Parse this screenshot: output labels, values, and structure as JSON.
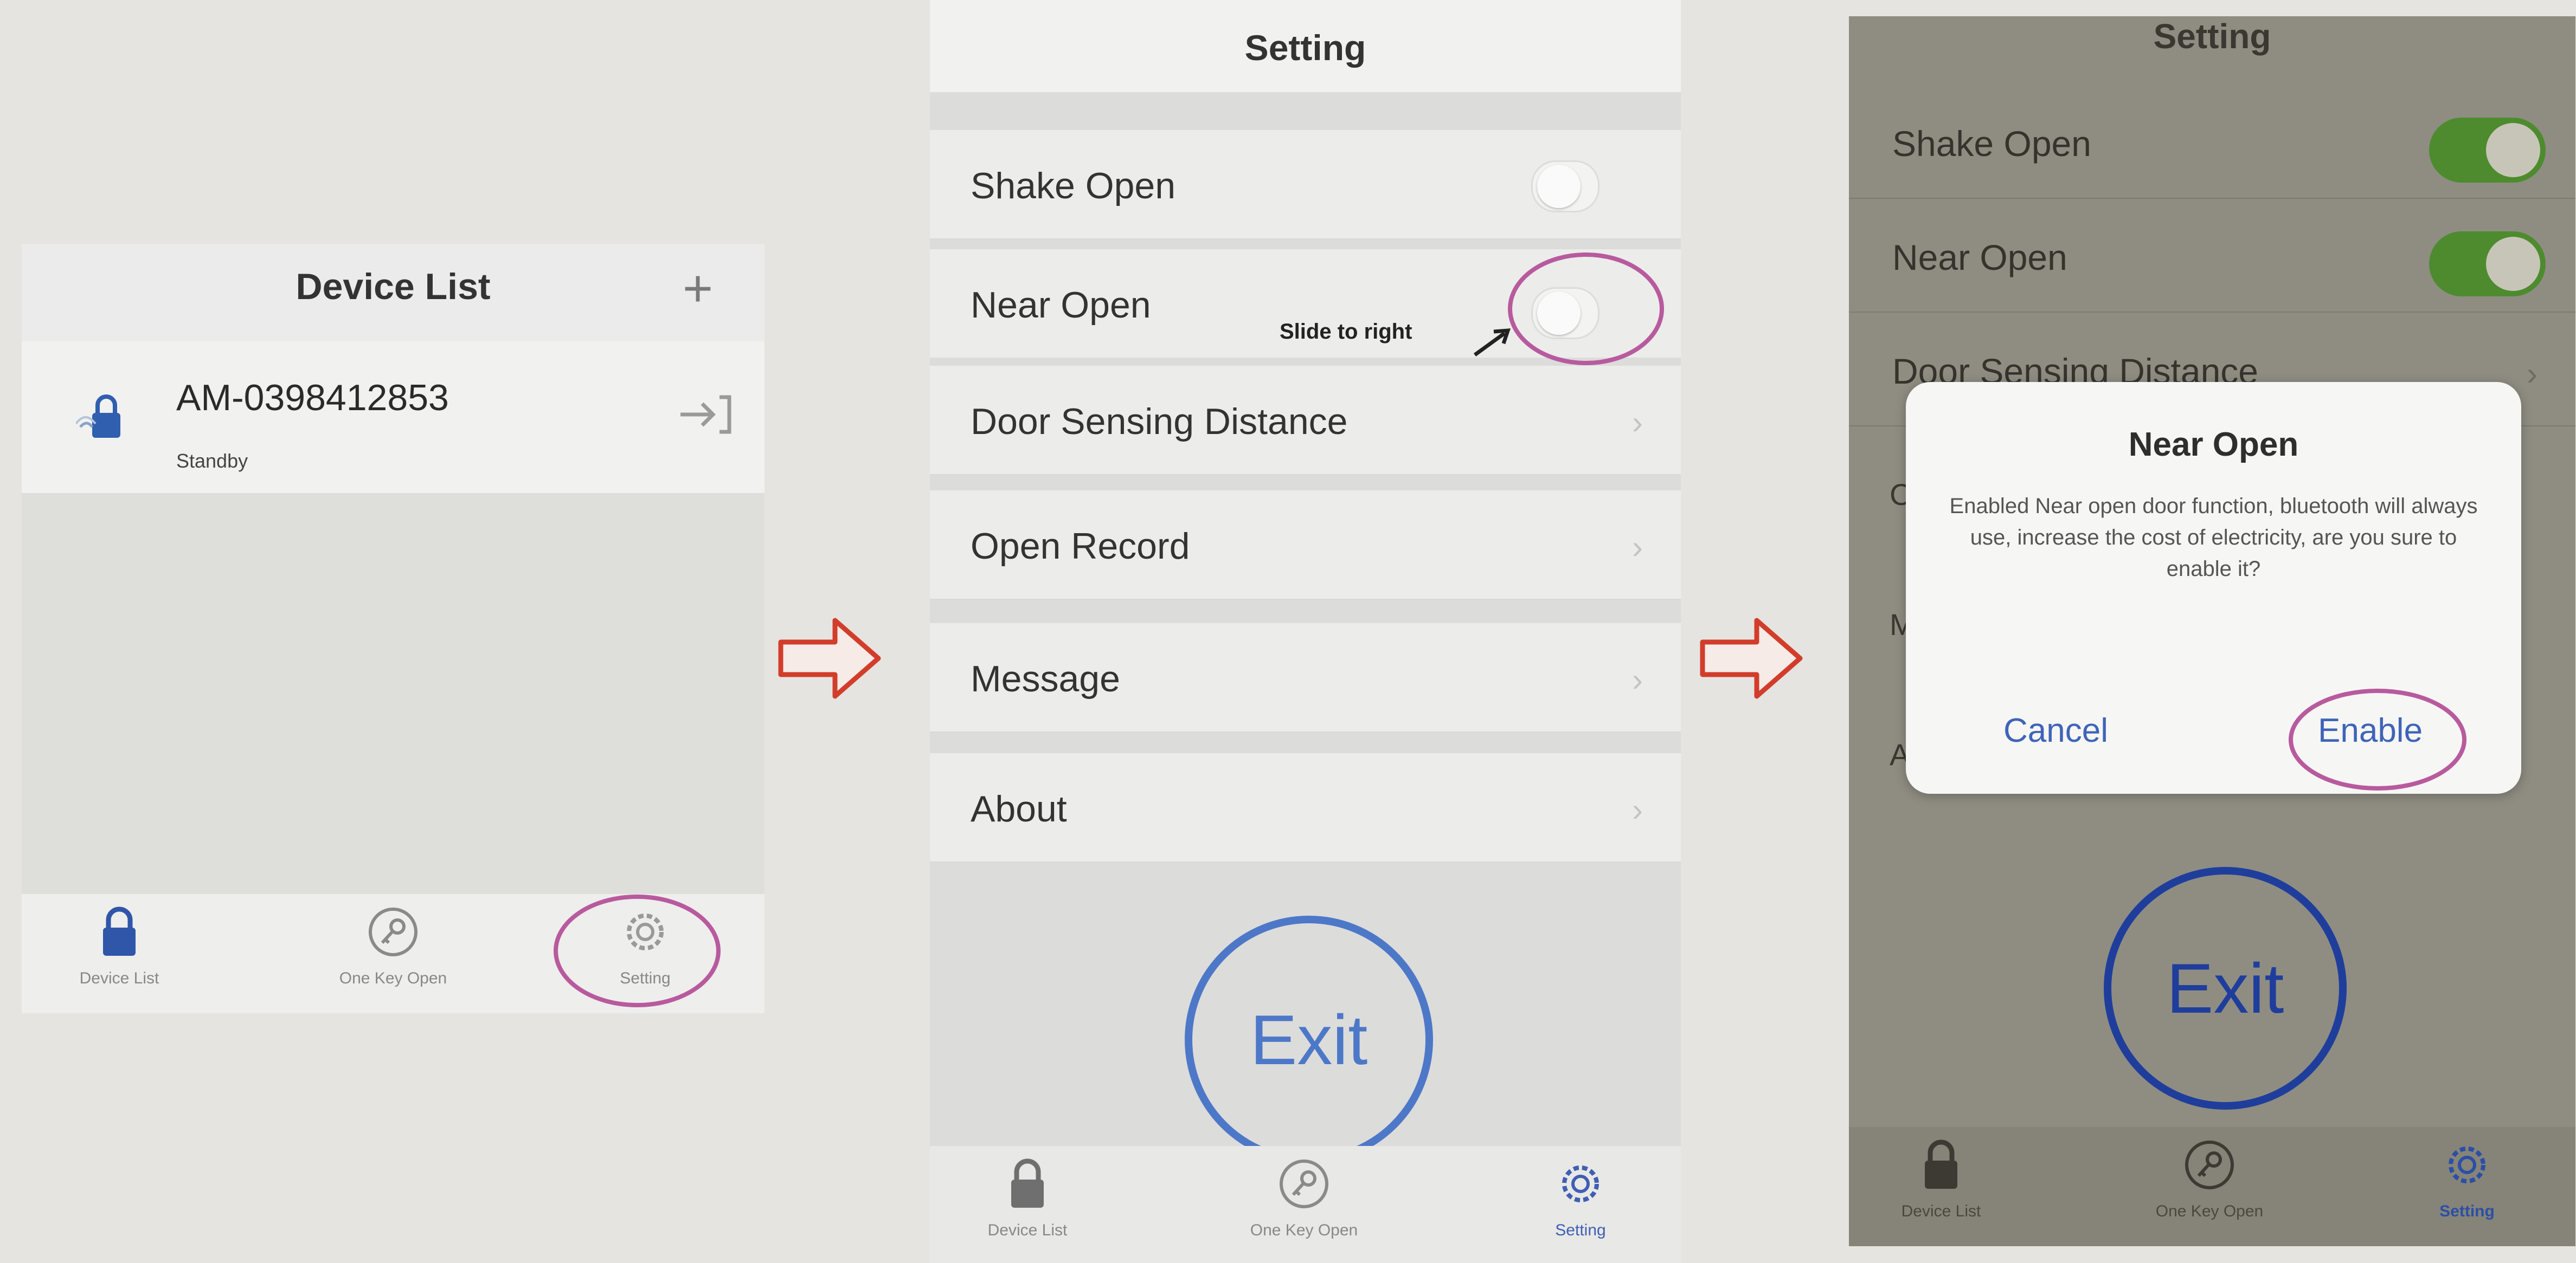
{
  "screen1": {
    "title": "Device List",
    "add_icon": "plus-icon",
    "device": {
      "name": "AM-0398412853",
      "status": "Standby"
    },
    "tabs": [
      "Device List",
      "One Key Open",
      "Setting"
    ]
  },
  "screen2": {
    "title": "Setting",
    "items": [
      "Shake Open",
      "Near Open",
      "Door Sensing Distance",
      "Open Record",
      "Message",
      "About"
    ],
    "annotation": "Slide to right",
    "exit_label": "Exit",
    "tabs": [
      "Device List",
      "One Key Open",
      "Setting"
    ]
  },
  "screen3": {
    "title": "Setting",
    "items": [
      "Shake Open",
      "Near Open",
      "Door Sensing Distance"
    ],
    "peek_letters": [
      "C",
      "M",
      "A"
    ],
    "dialog": {
      "title": "Near Open",
      "message": "Enabled Near open door function, bluetooth will always use, increase the cost of electricity, are you sure to enable it?",
      "cancel": "Cancel",
      "enable": "Enable"
    },
    "exit_label": "Exit",
    "tabs": [
      "Device List",
      "One Key Open",
      "Setting"
    ]
  },
  "colors": {
    "highlight_ring": "#b85a9e",
    "exit_ring_light": "#4d78c8",
    "exit_ring_dark": "#1f3e9c",
    "arrow": "#d23d2b",
    "toggle_on": "#4d8b2e",
    "tab_active": "#3f5fb4"
  }
}
